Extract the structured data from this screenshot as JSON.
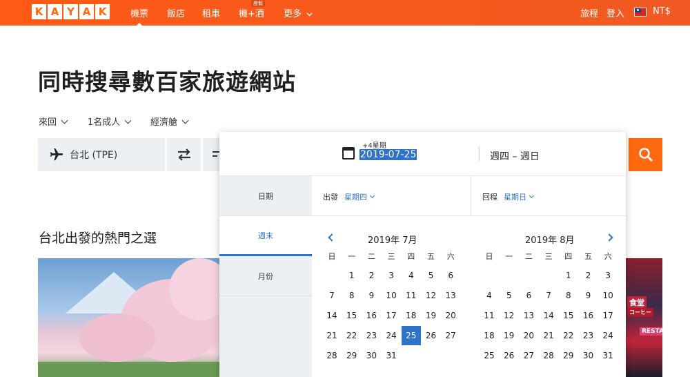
{
  "topbar": {
    "logo_letters": [
      "K",
      "A",
      "Y",
      "A",
      "K"
    ],
    "nav": [
      "機票",
      "飯店",
      "租車",
      "機+酒",
      "更多"
    ],
    "deal_tag": "度假",
    "right": [
      "旅程",
      "登入"
    ],
    "currency": "NT$"
  },
  "headline": "同時搜尋數百家旅遊網站",
  "options": {
    "trip_type": "來回",
    "travelers": "1名成人",
    "cabin": "經濟艙"
  },
  "search": {
    "origin": "台北 (TPE)"
  },
  "section_title": "台北出發的熱門之選",
  "photo_right_signs": [
    "食堂",
    "コーヒー",
    "RESTA"
  ],
  "datepicker": {
    "week_offset": "+4星期",
    "date_value": "2019-07-25",
    "day_range": "週四 – 週日",
    "side_tabs": [
      "日期",
      "週末",
      "月份"
    ],
    "depart_label": "出發",
    "depart_value": "星期四",
    "return_label": "回程",
    "return_value": "星期日",
    "weekdays": [
      "日",
      "一",
      "二",
      "三",
      "四",
      "五",
      "六"
    ],
    "months": [
      {
        "title": "2019年 7月",
        "weeks": [
          [
            "",
            "1",
            "2",
            "3",
            "4",
            "5",
            "6"
          ],
          [
            "7",
            "8",
            "9",
            "10",
            "11",
            "12",
            "13"
          ],
          [
            "14",
            "15",
            "16",
            "17",
            "18",
            "19",
            "20"
          ],
          [
            "21",
            "22",
            "23",
            "24",
            "25",
            "26",
            "27"
          ],
          [
            "28",
            "29",
            "30",
            "31",
            "",
            "",
            ""
          ]
        ],
        "selected": "25"
      },
      {
        "title": "2019年 8月",
        "weeks": [
          [
            "",
            "",
            "",
            "",
            "1",
            "2",
            "3"
          ],
          [
            "4",
            "5",
            "6",
            "7",
            "8",
            "9",
            "10"
          ],
          [
            "11",
            "12",
            "13",
            "14",
            "15",
            "16",
            "17"
          ],
          [
            "18",
            "19",
            "20",
            "21",
            "22",
            "23",
            "24"
          ],
          [
            "25",
            "26",
            "27",
            "28",
            "29",
            "30",
            "31"
          ]
        ],
        "selected": ""
      }
    ]
  },
  "colors": {
    "brand": "#ff690f",
    "accent": "#2f73c9"
  }
}
